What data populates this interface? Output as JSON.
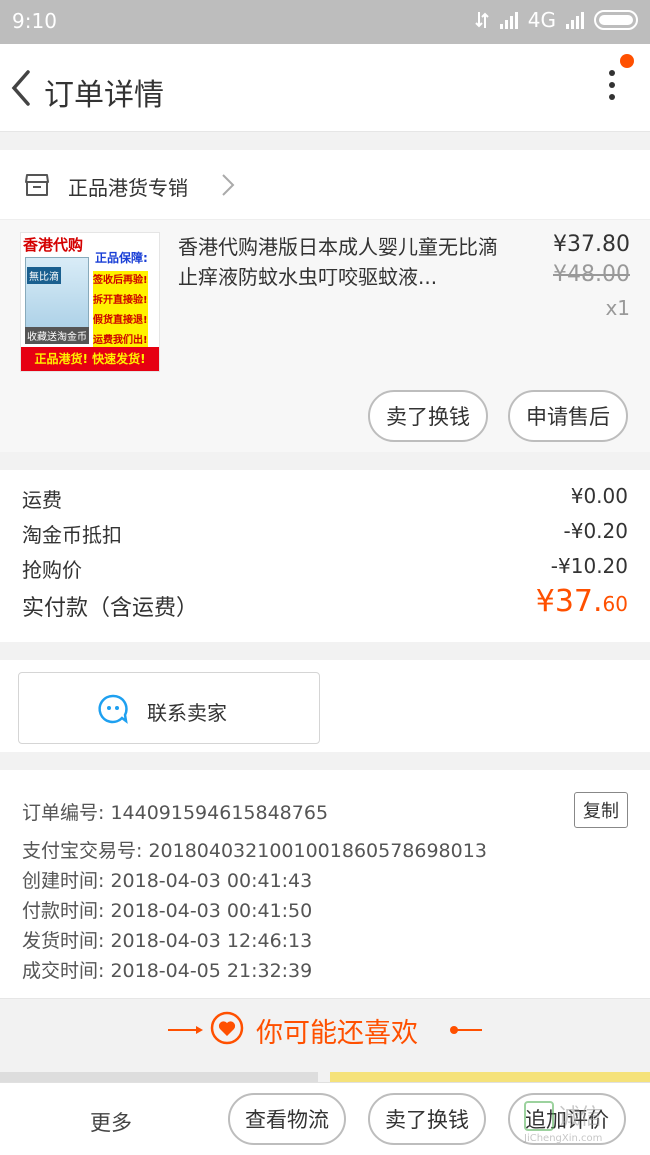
{
  "status_bar": {
    "time": "9:10",
    "network": "4G"
  },
  "header": {
    "title": "订单详情"
  },
  "shop": {
    "name": "正品港货专销"
  },
  "product": {
    "title": "香港代购港版日本成人婴儿童无比滴止痒液防蚊水虫叮咬驱蚊液...",
    "price": "¥37.80",
    "original_price": "¥48.00",
    "quantity": "x1",
    "image_text": {
      "header": "香港代购",
      "guarantee": "正品保障:",
      "lines": [
        "签收后再验!",
        "拆开直接验!",
        "假货直接退!",
        "运费我们出!"
      ],
      "box_label": "無比滴",
      "collect": "收藏送淘金币",
      "footer": "正品港货! 快速发货!"
    }
  },
  "item_actions": {
    "sell_label": "卖了换钱",
    "after_sale_label": "申请售后"
  },
  "fees": {
    "rows": [
      {
        "label": "运费",
        "value": "¥0.00"
      },
      {
        "label": "淘金币抵扣",
        "value": "-¥0.20"
      },
      {
        "label": "抢购价",
        "value": "-¥10.20"
      }
    ],
    "total_label": "实付款（含运费）",
    "total_main": "¥37.",
    "total_cents": "60"
  },
  "contact": {
    "label": "联系卖家"
  },
  "order_info": {
    "copy_label": "复制",
    "rows": [
      "订单编号: 144091594615848765",
      "支付宝交易号: 2018040321001001860578698013",
      "创建时间: 2018-04-03 00:41:43",
      "付款时间: 2018-04-03 00:41:50",
      "发货时间: 2018-04-03 12:46:13",
      "成交时间: 2018-04-05 21:32:39"
    ]
  },
  "recommend": {
    "title": "你可能还喜欢"
  },
  "bottom_bar": {
    "more_label": "更多",
    "logistics_label": "查看物流",
    "sell_label": "卖了换钱",
    "review_label": "追加评价"
  },
  "watermark": {
    "text": "诚信",
    "url": "JiChengXin.com"
  },
  "colors": {
    "accent": "#ff5000",
    "status_bar": "#bdbdbd",
    "page_bg": "#f2f2f2"
  }
}
